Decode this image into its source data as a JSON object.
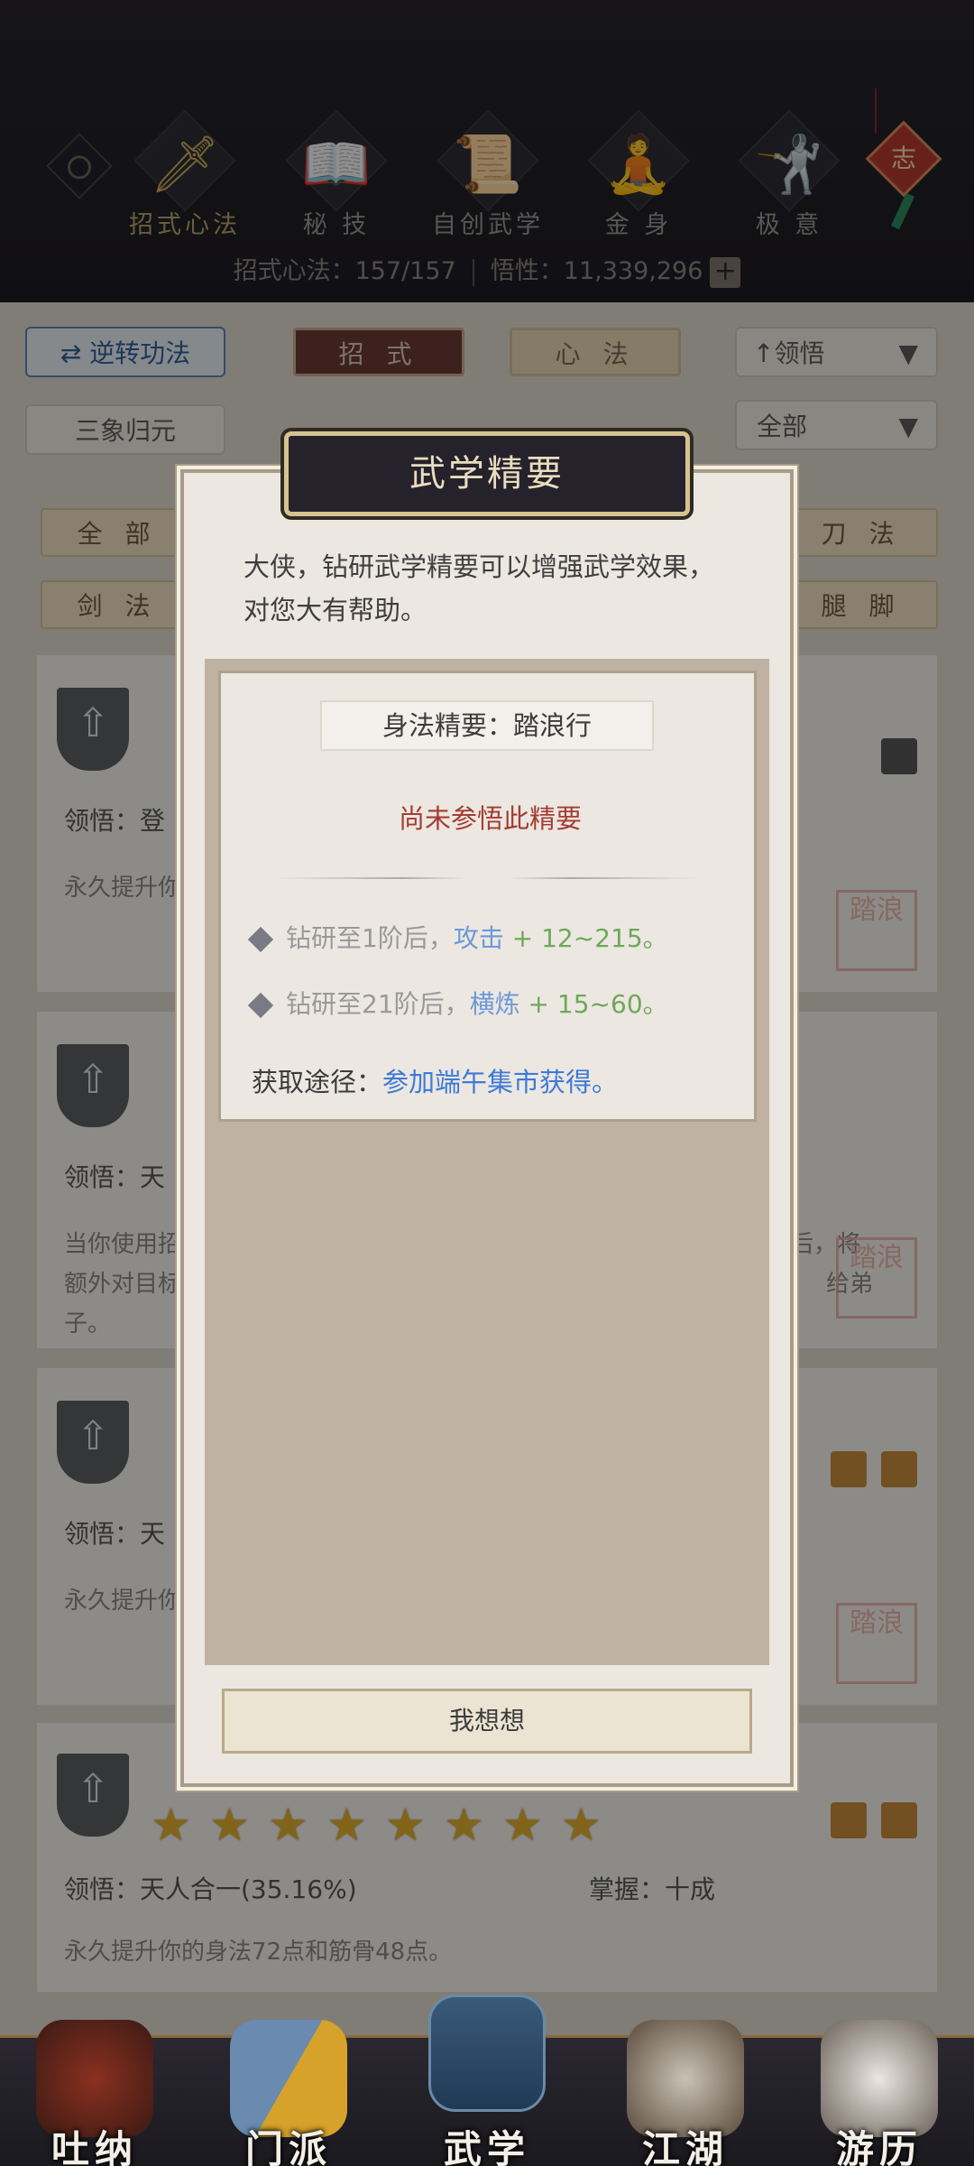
{
  "top_nav": {
    "tabs": [
      {
        "label": "招式心法",
        "icon": "sword-icon",
        "active": true
      },
      {
        "label": "秘 技",
        "icon": "book-icon"
      },
      {
        "label": "自创武学",
        "icon": "scroll-icon"
      },
      {
        "label": "金 身",
        "icon": "meditation-icon"
      },
      {
        "label": "极 意",
        "icon": "martial-stance-icon"
      }
    ],
    "stats_label": "招式心法：157/157",
    "wuxing_label": "悟性：11,339,296",
    "plus": "+",
    "knot_char": "志"
  },
  "filters": {
    "reverse": "逆转功法",
    "tab_moves": "招 式",
    "tab_heart": "心 法",
    "sort": "领悟",
    "sanxiang": "三象归元",
    "all_dropdown": "全部",
    "cat_all": "全 部",
    "cat_sword": "剑 法",
    "cat_blade": "刀 法",
    "cat_leg": "腿 脚"
  },
  "cards": [
    {
      "comprehend": "领悟：登",
      "desc": "永久提升你"
    },
    {
      "comprehend": "领悟：天",
      "desc": "当你使用招式攻击敌人后，将额外对目标造成伤害，效果提升给弟子。",
      "desc_left": "当你使用招",
      "desc_left2": "额外对目标",
      "desc_left3": "子。",
      "desc_right": "后，将",
      "desc_right2": "给弟"
    },
    {
      "comprehend": "领悟：天",
      "desc": "永久提升你"
    },
    {
      "comprehend": "领悟：天人合一(35.16%)",
      "mastery": "掌握：十成",
      "desc": "永久提升你的身法72点和筋骨48点。"
    }
  ],
  "seal_text": "踏浪",
  "modal": {
    "title": "武学精要",
    "intro": "大侠，钻研武学精要可以增强武学效果，对您大有帮助。",
    "essence_name": "身法精要：踏浪行",
    "status": "尚未参悟此精要",
    "rows": [
      {
        "pre": "钻研至1阶后，",
        "stat": "攻击",
        "value": " + 12~215。"
      },
      {
        "pre": "钻研至21阶后，",
        "stat": "横炼",
        "value": " + 15~60。"
      }
    ],
    "source_label": "获取途径：",
    "source_value": "参加端午集市获得。",
    "button": "我想想"
  },
  "bottom_nav": [
    {
      "label": "吐纳",
      "icon": "breathing-icon"
    },
    {
      "label": "门派",
      "icon": "sect-icon"
    },
    {
      "label": "武学",
      "icon": "martial-book-icon",
      "active": true
    },
    {
      "label": "江湖",
      "icon": "jianghu-hat-icon"
    },
    {
      "label": "游历",
      "icon": "horse-icon"
    }
  ],
  "colors": {
    "accent_gold": "#d6c390",
    "status_red": "#a43c32",
    "link_blue": "#3e7ad6",
    "value_green": "#6fa85a",
    "star": "#e0ad2a"
  }
}
